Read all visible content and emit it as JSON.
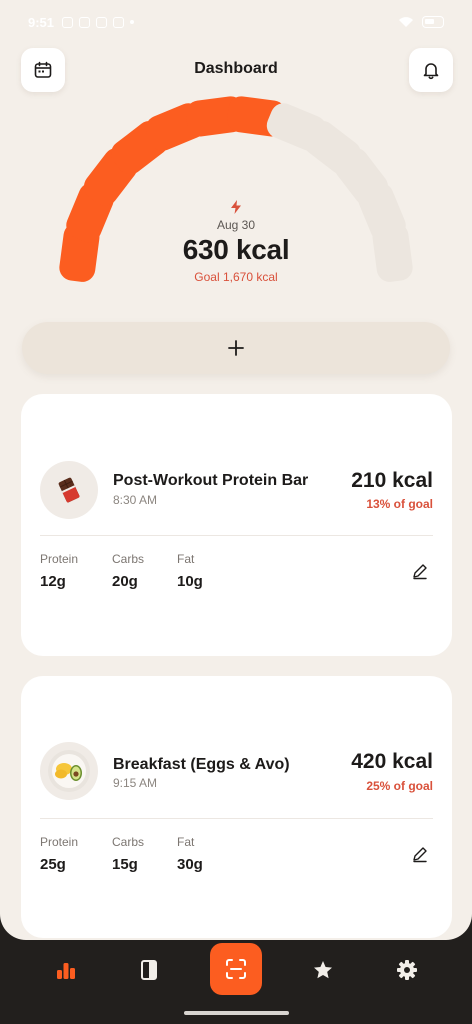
{
  "status_bar": {
    "time": "9:51"
  },
  "header": {
    "title": "Dashboard"
  },
  "gauge": {
    "date": "Aug 30",
    "calories": "630 kcal",
    "goal": "Goal 1,670 kcal",
    "filled_segments": 7,
    "total_segments": 12,
    "accent_color": "#fc5d20",
    "empty_color": "#ece6df"
  },
  "add_button": {
    "icon": "plus-icon"
  },
  "meals": [
    {
      "name": "Post-Workout Protein Bar",
      "time": "8:30 AM",
      "kcal": "210 kcal",
      "goal_pct": "13% of goal",
      "icon": "chocolate-bar-icon",
      "macros": [
        {
          "label": "Protein",
          "value": "12g"
        },
        {
          "label": "Carbs",
          "value": "20g"
        },
        {
          "label": "Fat",
          "value": "10g"
        }
      ]
    },
    {
      "name": "Breakfast (Eggs & Avo)",
      "time": "9:15 AM",
      "kcal": "420 kcal",
      "goal_pct": "25% of goal",
      "icon": "eggs-avocado-plate-icon",
      "macros": [
        {
          "label": "Protein",
          "value": "25g"
        },
        {
          "label": "Carbs",
          "value": "15g"
        },
        {
          "label": "Fat",
          "value": "30g"
        }
      ]
    }
  ],
  "nav": {
    "items": [
      "bar-chart-icon",
      "journal-icon",
      "scan-icon",
      "star-icon",
      "gear-icon"
    ],
    "active": "bar-chart-icon",
    "active_color": "#fc5d20"
  }
}
